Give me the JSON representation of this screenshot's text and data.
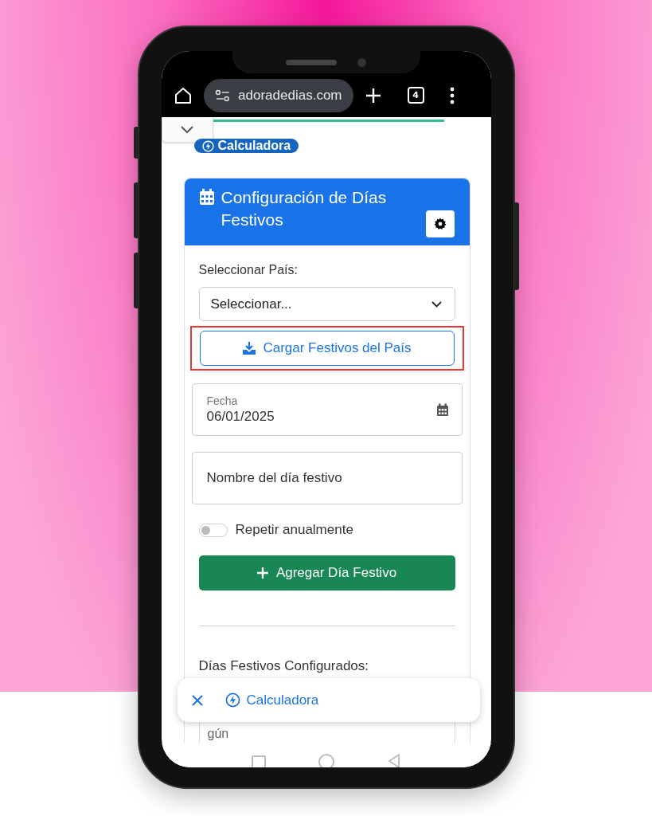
{
  "browser": {
    "url": "adoradedias.com",
    "tab_count": "4"
  },
  "badge": {
    "label": "Calculadora"
  },
  "card": {
    "title": "Configuración de Días Festivos",
    "country_label": "Seleccionar País:",
    "country_select": {
      "value": "Seleccionar..."
    },
    "load_button": {
      "label": "Cargar Festivos del País",
      "highlighted": true
    },
    "date_field": {
      "label": "Fecha",
      "value": "06/01/2025"
    },
    "name_field": {
      "placeholder": "Nombre del día festivo"
    },
    "repeat_toggle": {
      "label": "Repetir anualmente",
      "on": false
    },
    "add_button": {
      "label": "Agregar Día Festivo"
    },
    "configured_heading": "Días Festivos Configurados:",
    "empty_text": "gún"
  },
  "floating_bar": {
    "label": "Calculadora"
  }
}
